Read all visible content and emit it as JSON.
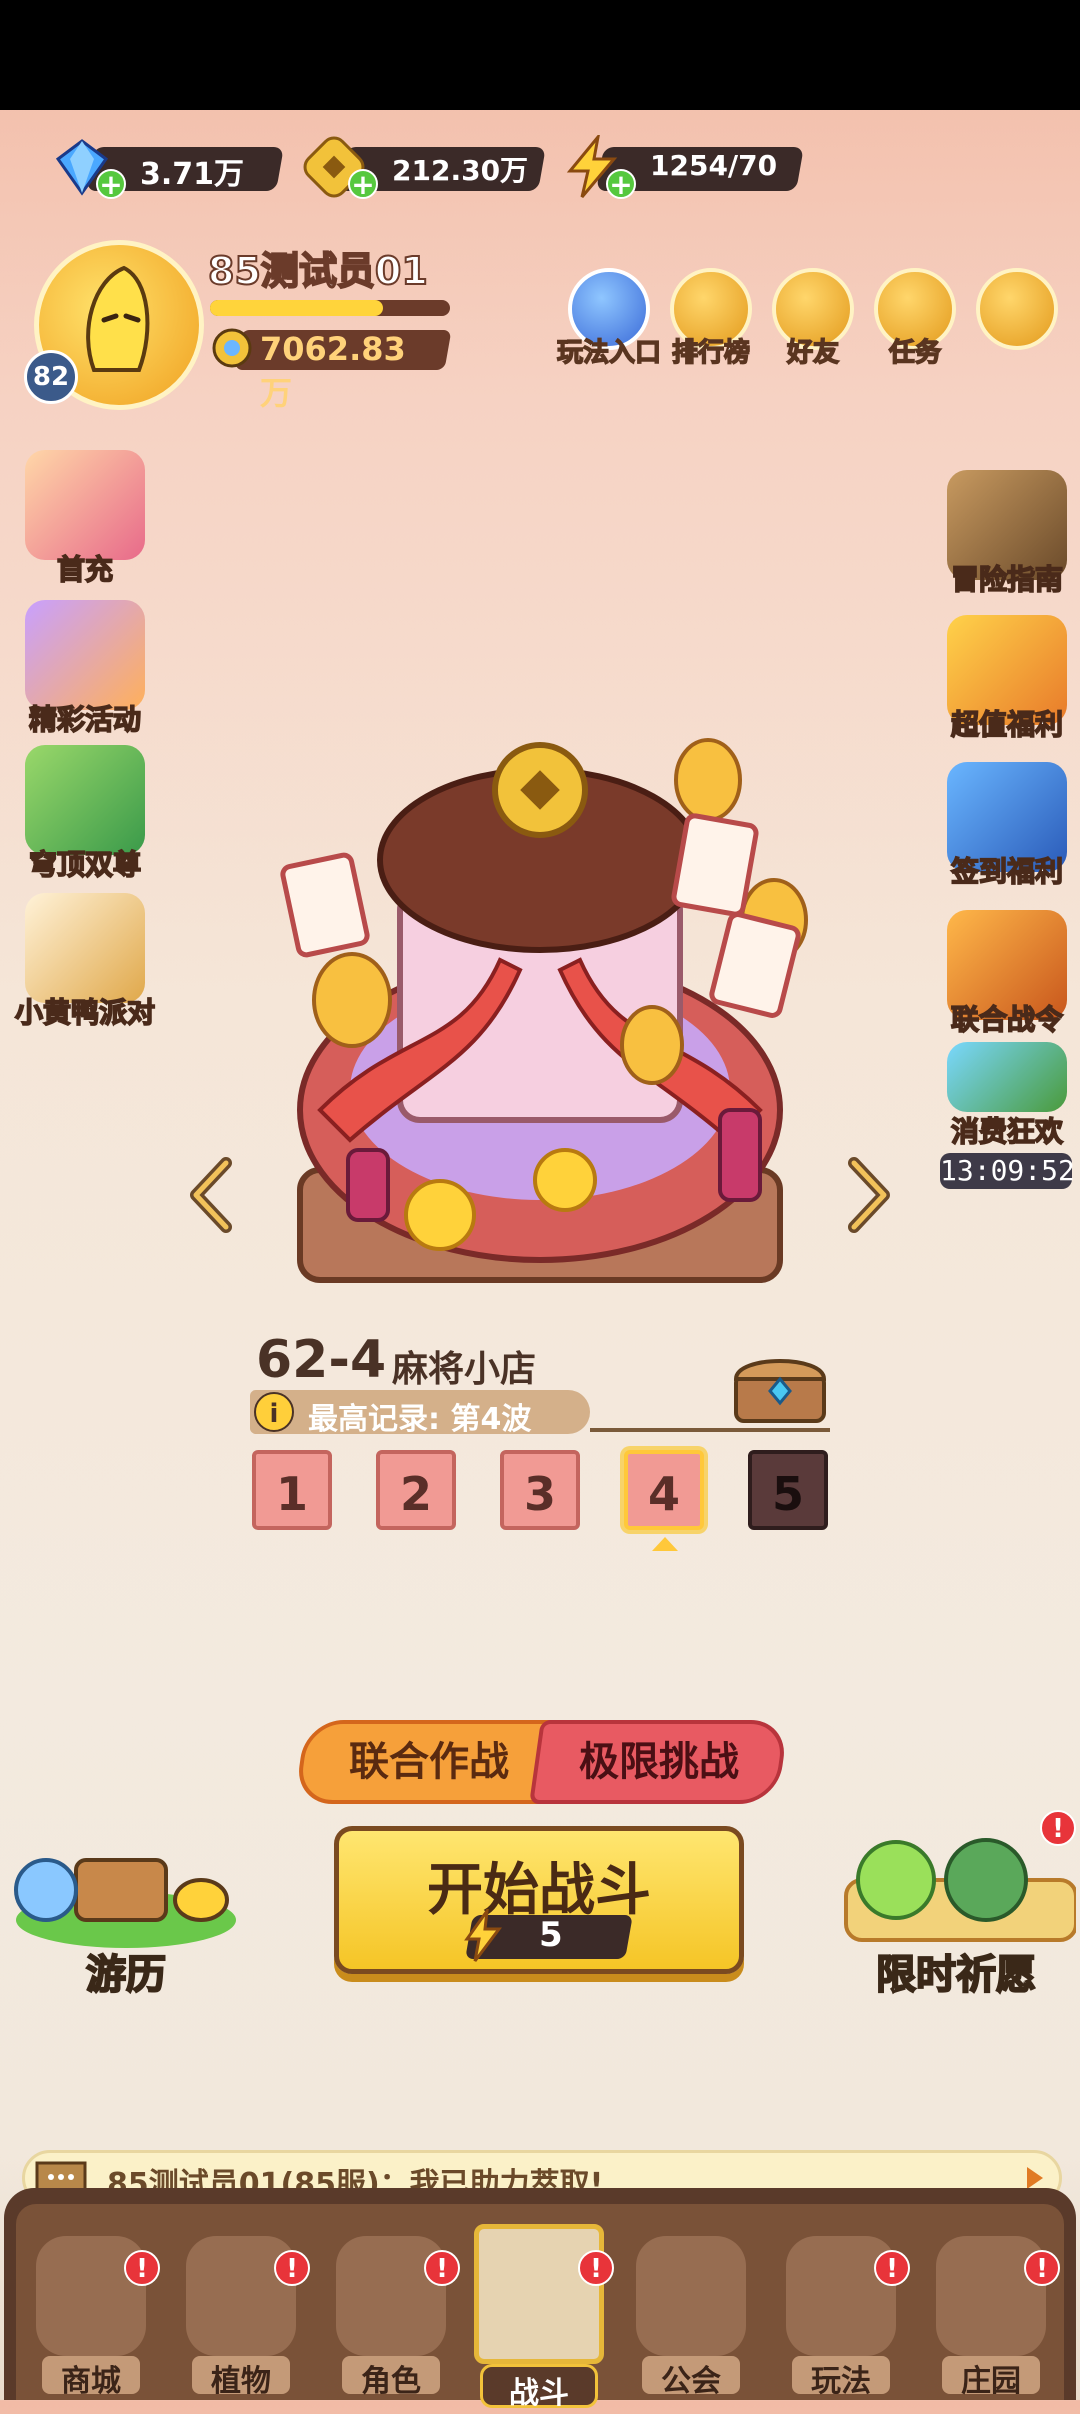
{
  "resources": {
    "gems": "3.71万",
    "coins": "212.30万",
    "energy": "1254/70"
  },
  "player": {
    "name": "85测试员01",
    "level": "82",
    "gold": "7062.83万",
    "exp_progress": 0.72
  },
  "top_menu": [
    "玩法入口",
    "排行榜",
    "好友",
    "任务"
  ],
  "left_side": [
    "首充",
    "精彩活动",
    "穹顶双尊",
    "小黄鸭派对"
  ],
  "right_side": [
    "冒险指南",
    "超值福利",
    "签到福利",
    "联合战令",
    "消费狂欢"
  ],
  "event_timer": "13:09:52",
  "stage": {
    "number": "62-4",
    "name": "麻将小店",
    "record": "最高记录: 第4波",
    "waves": [
      "1",
      "2",
      "3",
      "4",
      "5"
    ],
    "selected_wave": 4
  },
  "modes": {
    "coop": "联合作战",
    "limit": "极限挑战"
  },
  "start": {
    "label": "开始战斗",
    "cost": "5"
  },
  "corners": {
    "left": "游历",
    "right": "限时祈愿"
  },
  "chat": {
    "message": "85测试员01(85服)：我已助力萃取!"
  },
  "nav": [
    "商城",
    "植物",
    "角色",
    "战斗",
    "公会",
    "玩法",
    "庄园"
  ],
  "colors": {
    "accent_yellow": "#f5c526",
    "alert_red": "#e8343a",
    "nav_brown": "#5a3a2a"
  }
}
